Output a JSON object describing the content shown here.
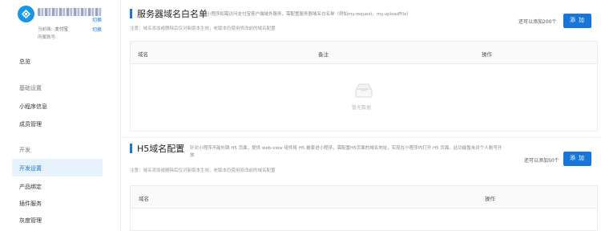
{
  "account": {
    "name": "支付宝小程序",
    "switch_label_1": "切换",
    "current_label": "当前端:",
    "current_value": "支付宝",
    "switch_label_2": "切换",
    "owner_label": "所属账号:"
  },
  "sidebar": {
    "overview": "总览",
    "group_basic": "基础设置",
    "miniapp_info": "小程序信息",
    "member_mgmt": "成员管理",
    "group_dev": "开发",
    "dev_settings": "开发设置",
    "product_binding": "产品绑定",
    "plugin_service": "插件服务",
    "gray_mgmt": "灰度管理"
  },
  "whitelist": {
    "title": "服务器域名白名单",
    "description": "小程序如需访问支付宝客户端域外服务，需配置服务器域名白名单（例如my.request、my.uploadFile）",
    "note": "注意：域名添加或删除后仅对新版本生效，老版本仍使用修改前的域名配置",
    "quota": "还可以添加200个",
    "add_label": "添 加",
    "col_domain": "域名",
    "col_remark": "备注",
    "col_action": "操作",
    "empty_text": "暂无数据"
  },
  "h5": {
    "title": "H5域名配置",
    "description": "针对小程序不能外跳 H5 页面，提供 web-view 组件将 H5 嵌套进小程序，需配置H5页面的域名地址，实现在小程序内打开 H5 页面。此功能暂未对个人账号开放",
    "note": "注意：域名添加或删除后仅对新版本生效，老版本仍使用修改前的域名配置",
    "quota": "还可以添加50个",
    "add_label": "添 加",
    "col_domain": "域名",
    "col_action": "操作"
  },
  "colors": {
    "accent": "#1677d9",
    "active_bg": "#e8f2fd",
    "page_bg": "#f5f5f5"
  }
}
